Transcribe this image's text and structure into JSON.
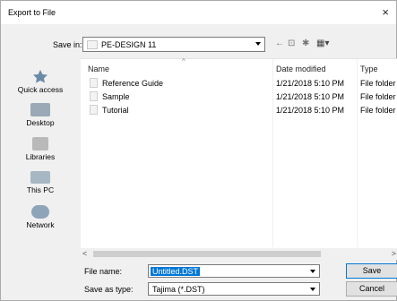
{
  "dialog": {
    "title": "Export to File",
    "close_glyph": "×"
  },
  "save_in": {
    "label": "Save in:",
    "value": "PE-DESIGN 11"
  },
  "toolbar": {
    "back_glyph": "←",
    "up_glyph": "⊡",
    "new_folder_glyph": "✱",
    "views_glyph": "▦▾"
  },
  "places": [
    {
      "label": "Quick access",
      "icon": "quick-access-star-icon"
    },
    {
      "label": "Desktop",
      "icon": "desktop-icon"
    },
    {
      "label": "Libraries",
      "icon": "libraries-icon"
    },
    {
      "label": "This PC",
      "icon": "computer-icon"
    },
    {
      "label": "Network",
      "icon": "network-icon"
    }
  ],
  "columns": {
    "name": "Name",
    "date": "Date modified",
    "type": "Type"
  },
  "files": [
    {
      "name": "Reference Guide",
      "date": "1/21/2018 5:10 PM",
      "type": "File folder"
    },
    {
      "name": "Sample",
      "date": "1/21/2018 5:10 PM",
      "type": "File folder"
    },
    {
      "name": "Tutorial",
      "date": "1/21/2018 5:10 PM",
      "type": "File folder"
    }
  ],
  "scroll": {
    "left": "<",
    "right": ">"
  },
  "filename": {
    "label": "File name:",
    "value": "Untitled.DST"
  },
  "savetype": {
    "label": "Save as type:",
    "value": "Tajima (*.DST)"
  },
  "buttons": {
    "save": "Save",
    "cancel": "Cancel"
  },
  "colors": {
    "selection": "#0078d7",
    "window_bg": "#f0f0f0"
  }
}
